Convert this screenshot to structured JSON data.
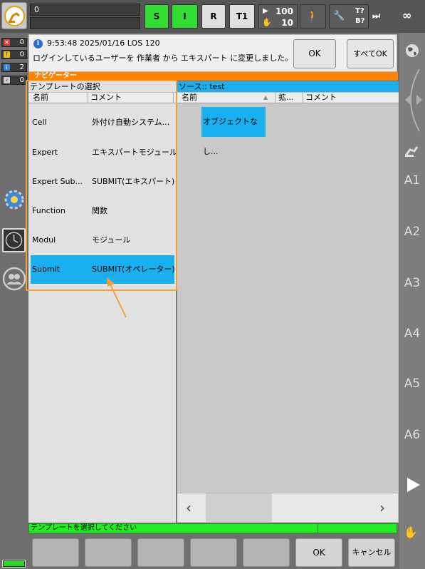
{
  "topbar": {
    "program_field": "0",
    "buttons": [
      "S",
      "I",
      "R",
      "T1"
    ],
    "speed_override": "100",
    "jog_override": "10",
    "tool_top": "T?",
    "tool_bottom": "B?",
    "incremental": "∞"
  },
  "message_counts": [
    "0",
    "0",
    "2",
    "0"
  ],
  "message": {
    "timestamp": "9:53:48 2025/01/16 LOS 120",
    "text": "ログインしているユーザーを 作業者 から エキスパート に変更しました。",
    "ok_label": "OK",
    "all_ok_label": "すべてOK"
  },
  "navigator": {
    "title": "ナビゲーター",
    "left_pane_title": "テンプレートの選択",
    "left_columns": [
      "名前",
      "コメント"
    ],
    "templates": [
      {
        "name": "Cell",
        "comment": "外付け自動システム..."
      },
      {
        "name": "Expert",
        "comment": "エキスパートモジュール"
      },
      {
        "name": "Expert Sub...",
        "comment": "SUBMIT(エキスパート)"
      },
      {
        "name": "Function",
        "comment": "関数"
      },
      {
        "name": "Modul",
        "comment": "モジュール"
      },
      {
        "name": "Submit",
        "comment": "SUBMIT(オペレーター)"
      }
    ],
    "selected_index": 5,
    "right_pane_title": "ソース:: test",
    "right_columns": [
      "名前",
      "拡...",
      "コメント"
    ],
    "right_item": "オブジェクトなし...",
    "scroll_left": "‹",
    "scroll_right": "›"
  },
  "sidebar_axes": [
    "A1",
    "A2",
    "A3",
    "A4",
    "A5",
    "A6"
  ],
  "statusbar": {
    "text": "テンプレートを選択してください"
  },
  "softkeys": {
    "ok_label": "OK",
    "cancel_label": "キャンセル"
  },
  "colors": {
    "accent_orange": "#ff8200",
    "selection_blue": "#1ab0f0",
    "status_green": "#22ee22",
    "mode_green": "#33dd33"
  }
}
